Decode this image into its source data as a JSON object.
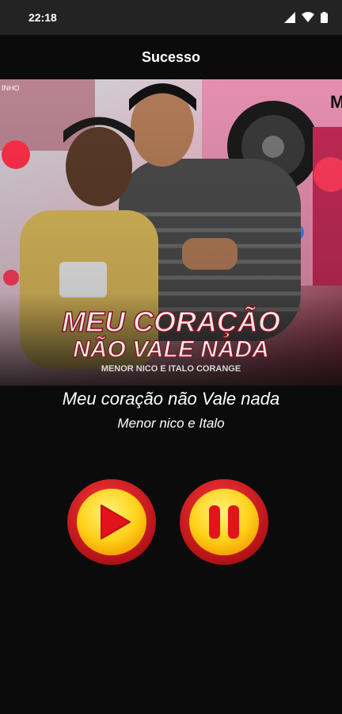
{
  "status_bar": {
    "time": "22:18",
    "icons": [
      "signal-icon",
      "wifi-icon",
      "battery-icon"
    ]
  },
  "app_bar": {
    "title": "Sucesso"
  },
  "cover": {
    "headline_line1": "MEU CORAÇÃO",
    "headline_line2": "NÃO VALE NADA",
    "subline": "MENOR NICO E ITALO CORANGE",
    "top_left_tag": "INHO",
    "top_right_tag": "M"
  },
  "track": {
    "title": "Meu coração não Vale nada",
    "artist": "Menor nico e Italo"
  },
  "controls": {
    "play_icon": "play-icon",
    "pause_icon": "pause-icon"
  },
  "colors": {
    "background": "#0b0b0b",
    "status_bar": "#232323",
    "button_ring": "#d8141c",
    "button_fill": "#ffd21a",
    "button_symbol": "#e3131b"
  }
}
